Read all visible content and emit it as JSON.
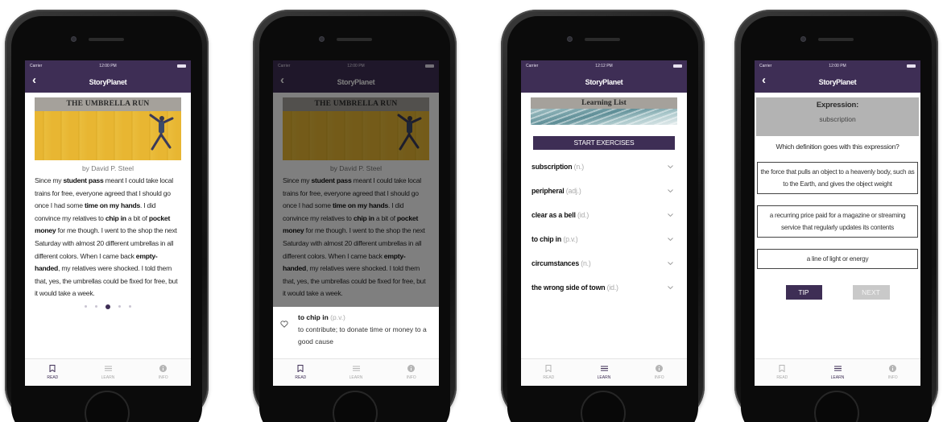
{
  "status": {
    "carrier": "Carrier",
    "time_1": "12:00 PM",
    "time_2": "12:00 PM",
    "time_3": "12:12 PM",
    "time_4": "12:00 PM"
  },
  "app_title": "StoryPlanet",
  "tabs": {
    "read": "READ",
    "learn": "LEARN",
    "info": "INFO"
  },
  "story": {
    "title": "THE UMBRELLA RUN",
    "byline": "by David P. Steel",
    "p1": "Since my ",
    "t1": "student pass",
    "p2": " meant I could take local trains for free, everyone agreed that I should go once I had some ",
    "t2": "time on my hands",
    "p3": ". I did convince my relatives to ",
    "t3": "chip in",
    "p4": " a bit of ",
    "t4": "pocket money",
    "p5": " for me though. I went to the shop the next Saturday with almost 20 different umbrellas in all different colors. When I came back ",
    "t5": "empty-handed",
    "p6": ", my relatives were shocked. I told them that, yes, the umbrellas could be fixed for free, but it would take a week."
  },
  "popup": {
    "term": "to chip in",
    "pos": "(p.v.)",
    "definition": "to contribute; to donate time or money to a good cause"
  },
  "learning_list": {
    "title": "Learning List",
    "start_button": "START EXERCISES",
    "items": [
      {
        "word": "subscription",
        "pos": "(n.)"
      },
      {
        "word": "peripheral",
        "pos": "(adj.)"
      },
      {
        "word": "clear as a bell",
        "pos": "(id.)"
      },
      {
        "word": "to chip in",
        "pos": "(p.v.)"
      },
      {
        "word": "circumstances",
        "pos": "(n.)"
      },
      {
        "word": "the wrong side of town",
        "pos": "(id.)"
      }
    ]
  },
  "exercise": {
    "label": "Expression:",
    "expression": "subscription",
    "question": "Which definition goes with this expression?",
    "options": [
      "the force that pulls an object to a heavenly body, such as to the Earth, and gives the object weight",
      "a recurring price paid for a magazine or streaming service that regularly updates its contents",
      "a line of light or energy"
    ],
    "tip_button": "TIP",
    "next_button": "NEXT"
  },
  "colors": {
    "brand_purple": "#3e2e55",
    "banner_yellow": "#e8b632",
    "title_gray": "#a5a19b"
  }
}
